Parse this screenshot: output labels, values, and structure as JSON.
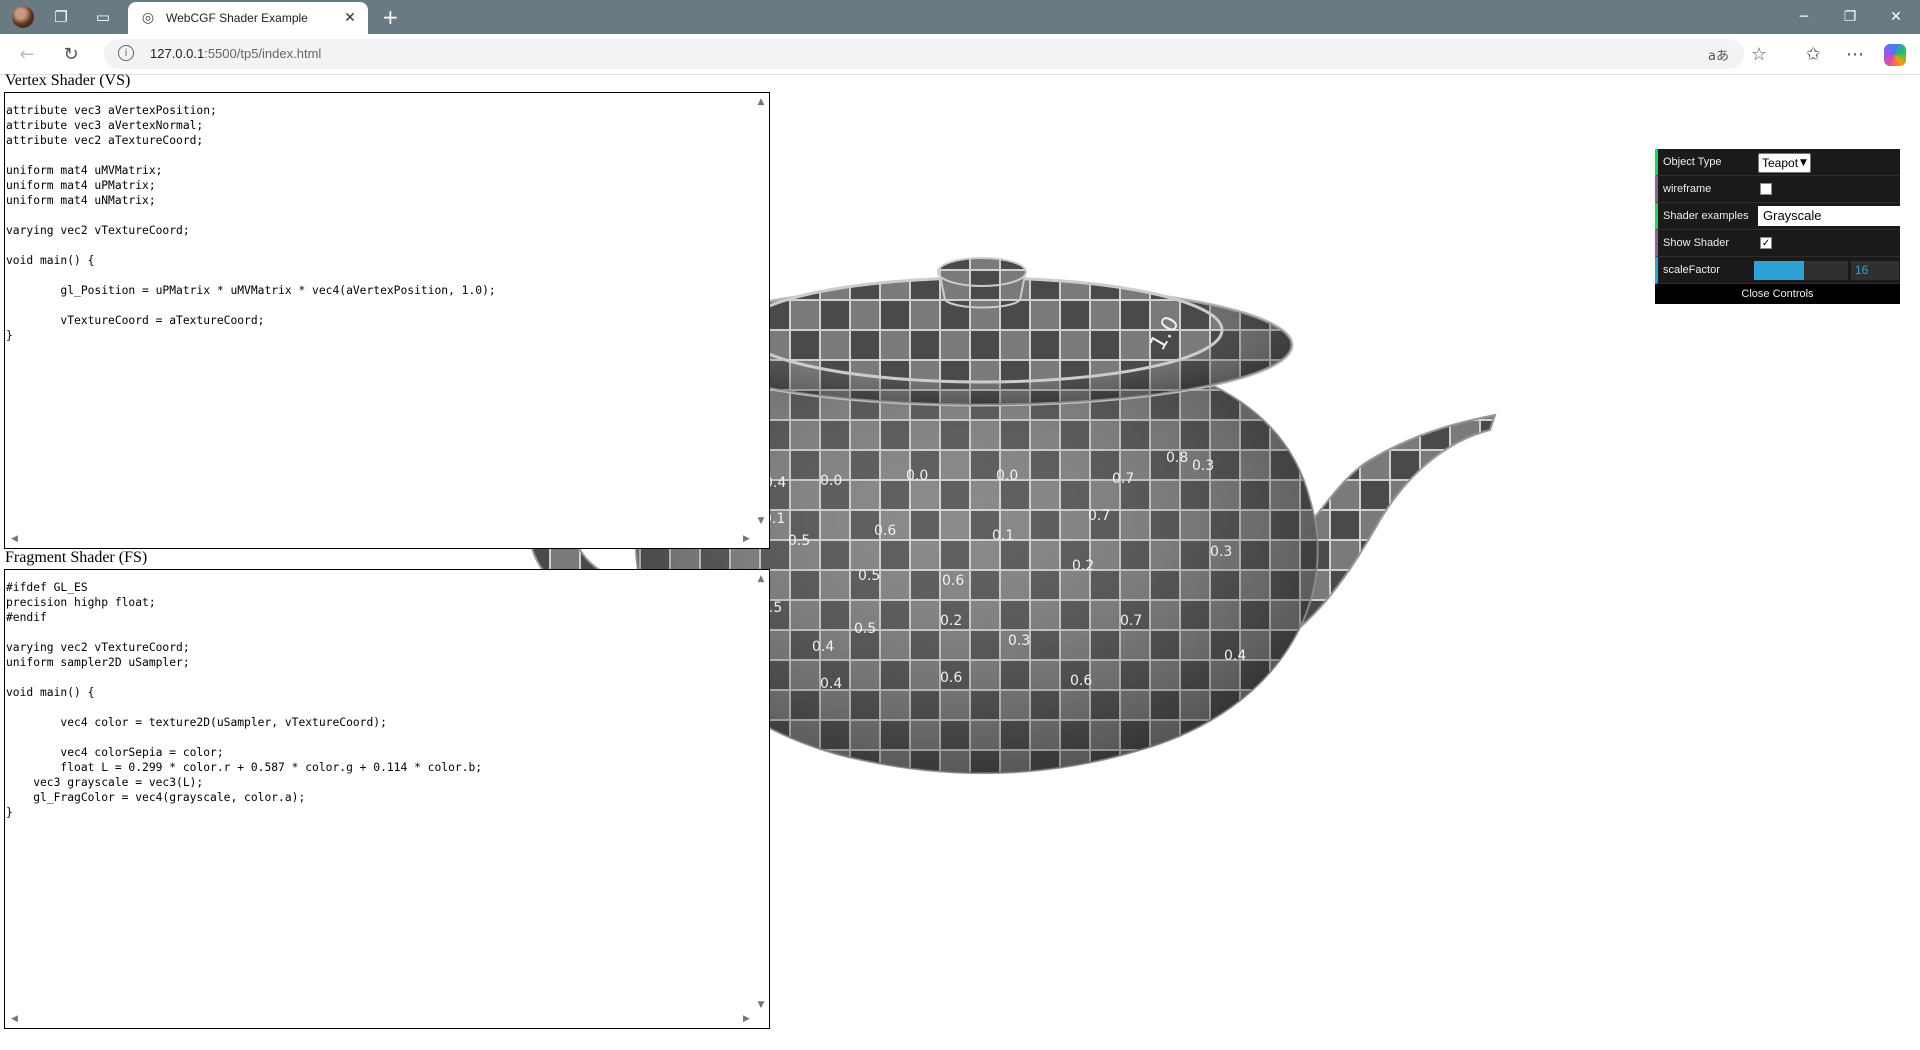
{
  "browser": {
    "tab_title": "WebCGF Shader Example",
    "url_host": "127.0.0.1",
    "url_rest": ":5500/tp5/index.html"
  },
  "icons": {
    "profile": "profile-avatar",
    "workspaces": "workspaces-icon",
    "tab_actions": "tab-actions-icon",
    "globe": "globe-icon",
    "close": "close-icon",
    "new_tab": "plus-icon",
    "back": "back-arrow-icon",
    "reload": "reload-icon",
    "info": "info-icon",
    "read_aloud": "read-aloud-icon",
    "favorite": "star-icon",
    "favorites": "favorites-icon",
    "more": "more-icon",
    "copilot": "copilot-icon"
  },
  "vertex_shader": {
    "label": "Vertex Shader (VS)",
    "code": "attribute vec3 aVertexPosition;\nattribute vec3 aVertexNormal;\nattribute vec2 aTextureCoord;\n\nuniform mat4 uMVMatrix;\nuniform mat4 uPMatrix;\nuniform mat4 uNMatrix;\n\nvarying vec2 vTextureCoord;\n\nvoid main() {\n\n        gl_Position = uPMatrix * uMVMatrix * vec4(aVertexPosition, 1.0);\n\n        vTextureCoord = aTextureCoord;\n}"
  },
  "fragment_shader": {
    "label": "Fragment Shader (FS)",
    "code": "#ifdef GL_ES\nprecision highp float;\n#endif\n\nvarying vec2 vTextureCoord;\nuniform sampler2D uSampler;\n\nvoid main() {\n\n        vec4 color = texture2D(uSampler, vTextureCoord);\n\n        vec4 colorSepia = color;\n        float L = 0.299 * color.r + 0.587 * color.g + 0.114 * color.b;\n    vec3 grayscale = vec3(L);\n    gl_FragColor = vec4(grayscale, color.a);\n}"
  },
  "gui": {
    "object_type_label": "Object Type",
    "object_type_value": "Teapot",
    "wireframe_label": "wireframe",
    "wireframe_checked": false,
    "shader_examples_label": "Shader examples",
    "shader_examples_value": "Grayscale",
    "show_shader_label": "Show Shader",
    "show_shader_checked": true,
    "scale_factor_label": "scaleFactor",
    "scale_factor_value": "16",
    "scale_factor_fraction": 0.53,
    "close_label": "Close Controls"
  },
  "teapot_labels": [
    "0.0",
    "0.4",
    "0.0",
    "0.0",
    "0.0",
    "0.7",
    "0.8",
    "0.5",
    "0.6",
    "0.1",
    "0.1",
    "0.1",
    "0.7",
    "0.5",
    "0.6",
    "0.2",
    "0.2",
    "0.7",
    "0.5",
    "0.3",
    "0.6",
    "0.4",
    "0.5",
    "0.4",
    "0.6",
    "1.0",
    "0.3",
    "0.3",
    "0.4"
  ],
  "colors": {
    "titlebar": "#6a7a82",
    "gui_bg": "#1a1a1a",
    "gui_accent_number": "#2fa1d6",
    "gui_accent_bool": "#806787",
    "gui_accent_string": "#1ed36f"
  }
}
